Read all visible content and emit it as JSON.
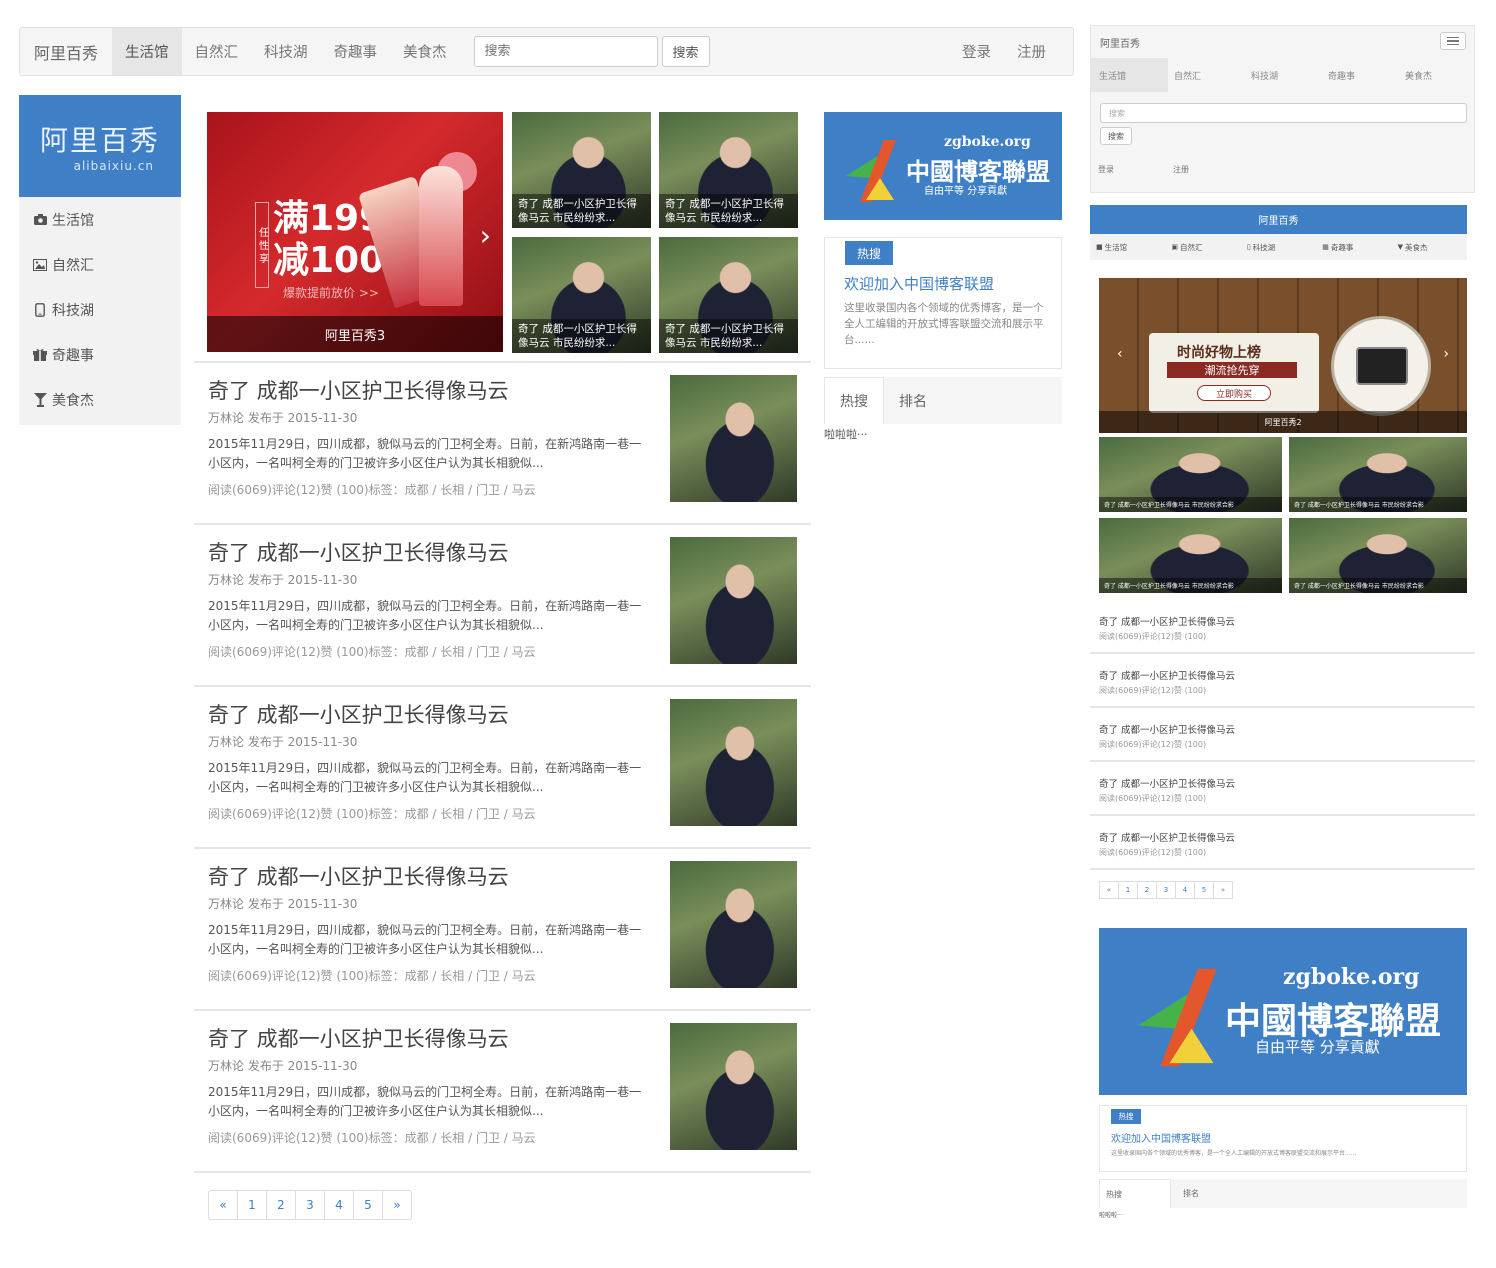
{
  "brand": "阿里百秀",
  "nav": {
    "items": [
      "生活馆",
      "自然汇",
      "科技湖",
      "奇趣事",
      "美食杰"
    ],
    "active_index": 0,
    "search_placeholder": "搜索",
    "search_button": "搜索",
    "login": "登录",
    "register": "注册"
  },
  "sidebar": {
    "logo_title": "阿里百秀",
    "logo_domain": "alibaixiu.cn",
    "items": [
      {
        "label": "生活馆",
        "icon": "camera-icon"
      },
      {
        "label": "自然汇",
        "icon": "picture-icon"
      },
      {
        "label": "科技湖",
        "icon": "phone-icon"
      },
      {
        "label": "奇趣事",
        "icon": "gift-icon"
      },
      {
        "label": "美食杰",
        "icon": "glass-icon"
      }
    ]
  },
  "carousel": {
    "promo_line1": "满199",
    "promo_line2": "减100",
    "promo_sub": "爆款提前放价 >>",
    "vertical_tag": "任 性 享",
    "caption": "阿里百秀3",
    "thumbs": [
      "奇了 成都一小区护卫长得像马云 市民纷纷求...",
      "奇了 成都一小区护卫长得像马云 市民纷纷求...",
      "奇了 成都一小区护卫长得像马云 市民纷纷求...",
      "奇了 成都一小区护卫长得像马云 市民纷纷求..."
    ]
  },
  "posts": [
    {
      "title": "奇了 成都一小区护卫长得像马云",
      "meta": "万林论 发布于 2015-11-30",
      "body": "2015年11月29日，四川成都，貌似马云的门卫柯全寿。日前，在新鸿路南一巷一小区内，一名叫柯全寿的门卫被许多小区住户认为其长相貌似...",
      "foot": "阅读(6069)评论(12)赞 (100)标签：成都 / 长相 / 门卫 / 马云"
    },
    {
      "title": "奇了 成都一小区护卫长得像马云",
      "meta": "万林论 发布于 2015-11-30",
      "body": "2015年11月29日，四川成都，貌似马云的门卫柯全寿。日前，在新鸿路南一巷一小区内，一名叫柯全寿的门卫被许多小区住户认为其长相貌似...",
      "foot": "阅读(6069)评论(12)赞 (100)标签：成都 / 长相 / 门卫 / 马云"
    },
    {
      "title": "奇了 成都一小区护卫长得像马云",
      "meta": "万林论 发布于 2015-11-30",
      "body": "2015年11月29日，四川成都，貌似马云的门卫柯全寿。日前，在新鸿路南一巷一小区内，一名叫柯全寿的门卫被许多小区住户认为其长相貌似...",
      "foot": "阅读(6069)评论(12)赞 (100)标签：成都 / 长相 / 门卫 / 马云"
    },
    {
      "title": "奇了 成都一小区护卫长得像马云",
      "meta": "万林论 发布于 2015-11-30",
      "body": "2015年11月29日，四川成都，貌似马云的门卫柯全寿。日前，在新鸿路南一巷一小区内，一名叫柯全寿的门卫被许多小区住户认为其长相貌似...",
      "foot": "阅读(6069)评论(12)赞 (100)标签：成都 / 长相 / 门卫 / 马云"
    },
    {
      "title": "奇了 成都一小区护卫长得像马云",
      "meta": "万林论 发布于 2015-11-30",
      "body": "2015年11月29日，四川成都，貌似马云的门卫柯全寿。日前，在新鸿路南一巷一小区内，一名叫柯全寿的门卫被许多小区住户认为其长相貌似...",
      "foot": "阅读(6069)评论(12)赞 (100)标签：成都 / 长相 / 门卫 / 马云"
    }
  ],
  "pagination": [
    "«",
    "1",
    "2",
    "3",
    "4",
    "5",
    "»"
  ],
  "ad_banner": {
    "url": "zgboke.org",
    "name": "中國博客聯盟",
    "slogan": "自由平等  分享貢獻"
  },
  "hot_box": {
    "badge": "热搜",
    "title": "欢迎加入中国博客联盟",
    "desc": "这里收录国内各个领域的优秀博客，是一个全人工编辑的开放式博客联盟交流和展示平台......"
  },
  "tabs": {
    "items": [
      "热搜",
      "排名"
    ],
    "content": "啦啦啦···"
  },
  "mobile": {
    "brand_bar": "阿里百秀",
    "carousel_line1": "时尚好物上榜",
    "carousel_line2": "潮流抢先穿",
    "carousel_button": "立即购买",
    "carousel_caption": "阿里百秀2",
    "thumb_caption": "奇了 成都一小区护卫长得像马云 市民纷纷求合影",
    "list_title": "奇了 成都一小区护卫长得像马云",
    "list_meta": "阅读(6069)评论(12)赞 (100)",
    "hot_desc": "这里收录国内各个领域的优秀博客，是一个全人工编辑的开放式博客联盟交流和展示平台......"
  },
  "colors": {
    "accent": "#3f7fc6",
    "promo_red": "#c8202a"
  }
}
